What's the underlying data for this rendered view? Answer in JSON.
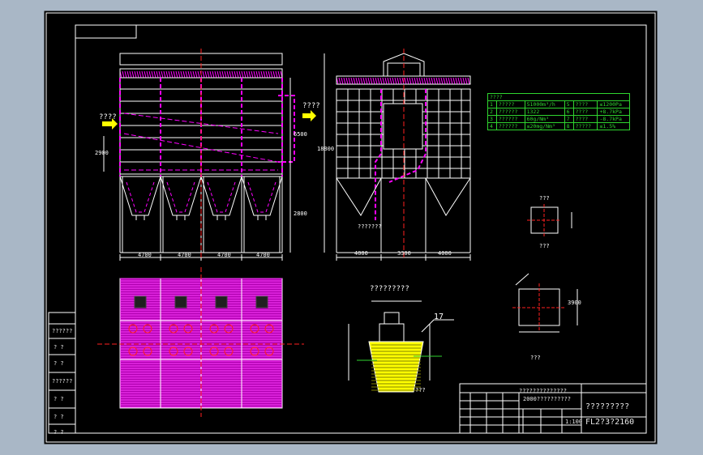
{
  "drawing": {
    "inlet_label_left": "????",
    "inlet_label_right": "????",
    "side_note": "???????",
    "detail_title": "?????????",
    "detail_callout": "17",
    "detail_cap_label": "???",
    "frame_label_top": "???",
    "frame_label_bottom": "???",
    "company_line1": "??????????????",
    "company_line2": "2000??????????",
    "title_block_name": "?????????",
    "title_block_code": "FL2?3?2160",
    "title_block_scale": "1:100"
  },
  "left_panel": {
    "rows": [
      "??????",
      "? ?",
      "? ?",
      "??????",
      "? ?",
      "? ?",
      "? ?"
    ]
  },
  "spec_table": {
    "header": "????",
    "rows": [
      {
        "n": "1",
        "k": "?????",
        "v": "51000m³/h",
        "n2": "5",
        "k2": "????",
        "v2": "≤1200Pa"
      },
      {
        "n": "2",
        "k": "??????",
        "v": "1322",
        "n2": "6",
        "k2": "????",
        "v2": "+8.7kPa"
      },
      {
        "n": "3",
        "k": "??????",
        "v": "60g/Nm³",
        "n2": "7",
        "k2": "????",
        "v2": "-8.7kPa"
      },
      {
        "n": "4",
        "k": "??????",
        "v": "≤20mg/Nm³",
        "n2": "8",
        "k2": "?????",
        "v2": "≤1.5%"
      }
    ]
  },
  "dims": {
    "left_bottom": [
      "4700",
      "4700",
      "4700",
      "4700"
    ],
    "side_bottom": [
      "4000",
      "3300",
      "4000"
    ],
    "left_height": "2900",
    "left_h2": "6500",
    "left_h3": "2800",
    "side_h": "18800",
    "frame_small": "???",
    "frame_large": "3900"
  },
  "colors": {
    "background": "#000000",
    "frame": "#ffffff",
    "magenta": "#ff00ff",
    "green": "#2fd52f",
    "yellow": "#ffff00",
    "red": "#ff2020"
  }
}
